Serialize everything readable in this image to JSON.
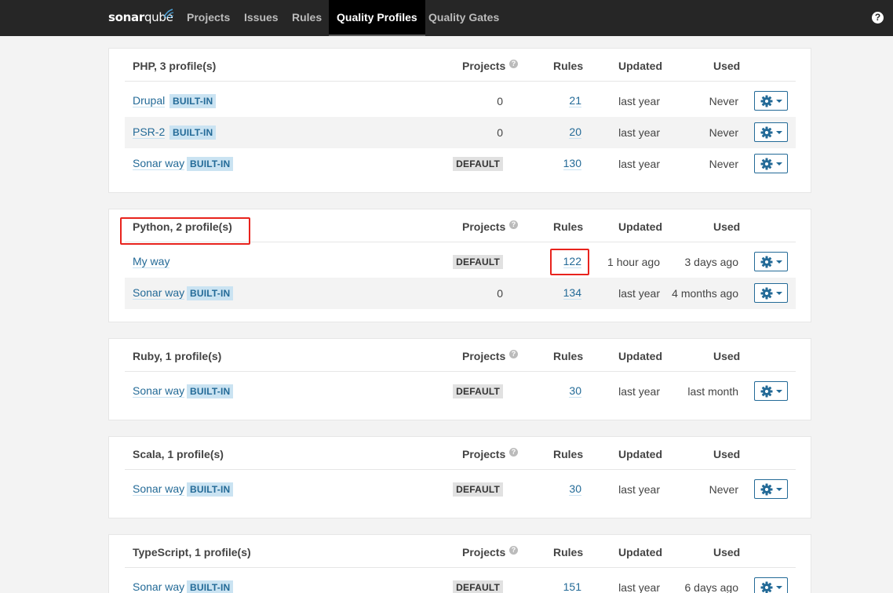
{
  "nav": {
    "logo_bold": "sonar",
    "logo_light": "qube",
    "items": [
      "Projects",
      "Issues",
      "Rules",
      "Quality Profiles",
      "Quality Gates"
    ],
    "help": "?"
  },
  "columns": {
    "projects": "Projects",
    "rules": "Rules",
    "updated": "Updated",
    "used": "Used",
    "help": "?"
  },
  "badges": {
    "builtin": "BUILT-IN",
    "default": "DEFAULT"
  },
  "languages": [
    {
      "title": "PHP, 3 profile(s)",
      "profiles": [
        {
          "name": "Drupal",
          "builtin": true,
          "projects": "0",
          "rules": "21",
          "updated": "last year",
          "used": "Never"
        },
        {
          "name": "PSR-2",
          "builtin": true,
          "projects": "0",
          "rules": "20",
          "updated": "last year",
          "used": "Never"
        },
        {
          "name": "Sonar way",
          "builtin": true,
          "default": true,
          "rules": "130",
          "updated": "last year",
          "used": "Never"
        }
      ]
    },
    {
      "title": "Python, 2 profile(s)",
      "profiles": [
        {
          "name": "My way",
          "builtin": false,
          "default": true,
          "rules": "122",
          "updated": "1 hour ago",
          "used": "3 days ago"
        },
        {
          "name": "Sonar way",
          "builtin": true,
          "projects": "0",
          "rules": "134",
          "updated": "last year",
          "used": "4 months ago"
        }
      ]
    },
    {
      "title": "Ruby, 1 profile(s)",
      "profiles": [
        {
          "name": "Sonar way",
          "builtin": true,
          "default": true,
          "rules": "30",
          "updated": "last year",
          "used": "last month"
        }
      ]
    },
    {
      "title": "Scala, 1 profile(s)",
      "profiles": [
        {
          "name": "Sonar way",
          "builtin": true,
          "default": true,
          "rules": "30",
          "updated": "last year",
          "used": "Never"
        }
      ]
    },
    {
      "title": "TypeScript, 1 profile(s)",
      "profiles": [
        {
          "name": "Sonar way",
          "builtin": true,
          "default": true,
          "rules": "151",
          "updated": "last year",
          "used": "6 days ago"
        }
      ]
    }
  ],
  "colors": {
    "nav_bg": "#262626",
    "link": "#236a97",
    "builtin_bg": "#cae3f2",
    "highlight": "#e8231d"
  }
}
